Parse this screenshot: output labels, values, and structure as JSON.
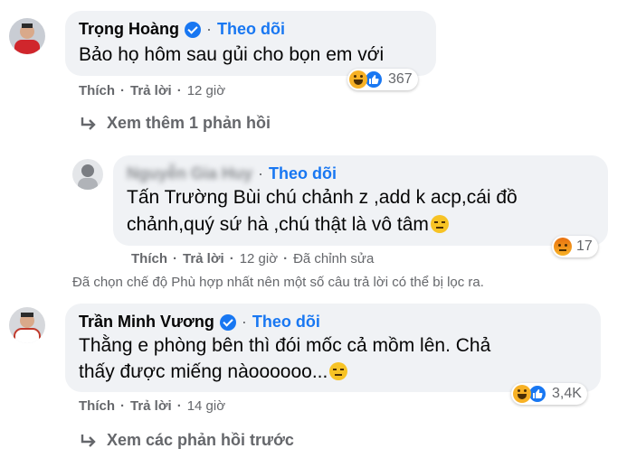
{
  "comments": [
    {
      "author": "Trọng Hoàng",
      "follow": "Theo dõi",
      "text": "Bảo họ hôm sau gủi cho bọn em với",
      "actions": {
        "like": "Thích",
        "reply": "Trả lời",
        "time": "12 giờ"
      },
      "reaction_count": "367",
      "reaction_icons": [
        "haha-icon",
        "like-icon"
      ]
    },
    {
      "author": "Nguyễn Gia Huy",
      "follow": "Theo dõi",
      "text_line1": "Tấn Trường Bùi chú chảnh z ,add k acp,cái đồ",
      "text_line2": "chảnh,quý sứ hà ,chú thật là vô tâm",
      "actions": {
        "like": "Thích",
        "reply": "Trả lời",
        "time": "12 giờ",
        "edited": "Đã chỉnh sửa"
      },
      "reaction_count": "17",
      "reaction_icons": [
        "angry-icon"
      ]
    },
    {
      "author": "Trần Minh Vương",
      "follow": "Theo dõi",
      "text_line1": "Thằng e phòng bên thì đói mốc cả mồm lên. Chả",
      "text_line2": "thấy được miếng nàoooooo...",
      "actions": {
        "like": "Thích",
        "reply": "Trả lời",
        "time": "14 giờ"
      },
      "reaction_count": "3,4K",
      "reaction_icons": [
        "haha-icon",
        "like-icon"
      ]
    }
  ],
  "view_more_replies": "Xem thêm 1 phản hồi",
  "filter_note": "Đã chọn chế độ Phù hợp nhất nên một số câu trả lời có thể bị lọc ra.",
  "view_previous_replies": "Xem các phản hồi trước",
  "colors": {
    "accent": "#1877f2",
    "bubble": "#f0f2f5",
    "meta": "#65676b"
  }
}
